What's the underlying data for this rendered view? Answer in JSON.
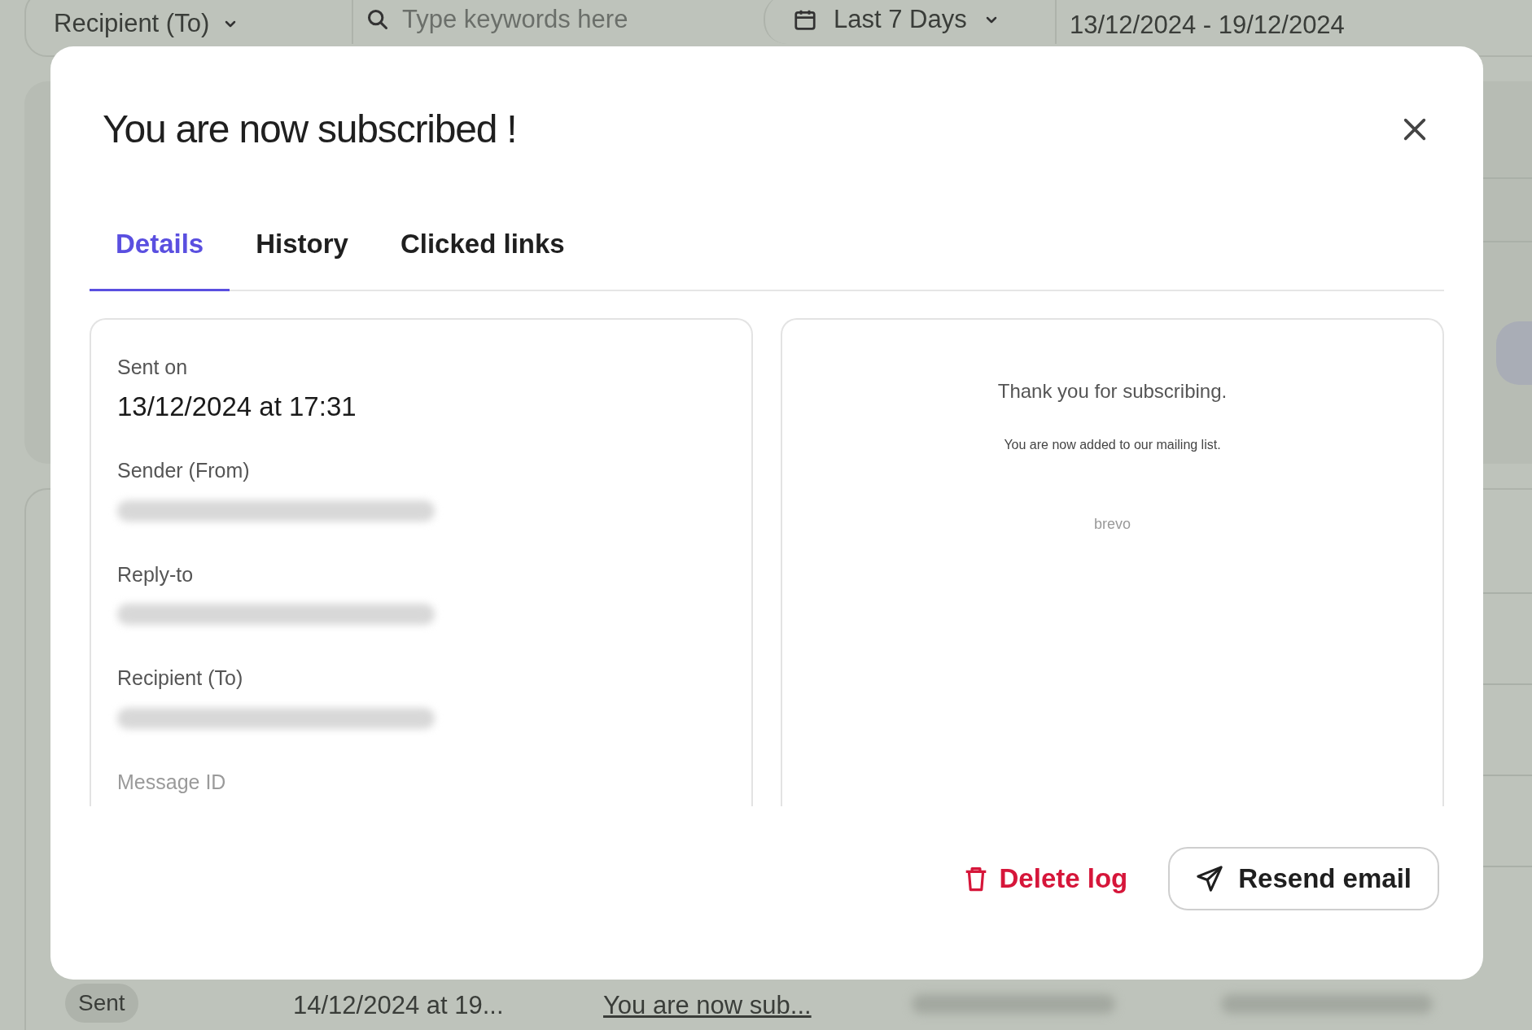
{
  "filter_bar": {
    "recipient_dropdown": "Recipient (To)",
    "search": {
      "placeholder": "Type keywords here"
    },
    "period_dropdown": "Last 7 Days",
    "date_range": "13/12/2024 - 19/12/2024"
  },
  "background_row": {
    "status": "Sent",
    "date": "14/12/2024 at 19...",
    "subject": "You are now sub..."
  },
  "modal": {
    "title": "You are now subscribed !",
    "tabs": [
      {
        "label": "Details",
        "selected": true
      },
      {
        "label": "History",
        "selected": false
      },
      {
        "label": "Clicked links",
        "selected": false
      }
    ],
    "details": [
      {
        "kind": "text",
        "label": "Sent on",
        "value": "13/12/2024 at 17:31"
      },
      {
        "kind": "redacted",
        "label": "Sender (From)"
      },
      {
        "kind": "redacted",
        "label": "Reply-to"
      },
      {
        "kind": "redacted",
        "label": "Recipient (To)"
      },
      {
        "kind": "faded",
        "label": "Message ID"
      }
    ],
    "preview": {
      "heading": "Thank you for subscribing.",
      "body": "You are now added to our mailing list.",
      "footer": "brevo"
    },
    "actions": {
      "delete": "Delete log",
      "resend": "Resend email"
    }
  }
}
